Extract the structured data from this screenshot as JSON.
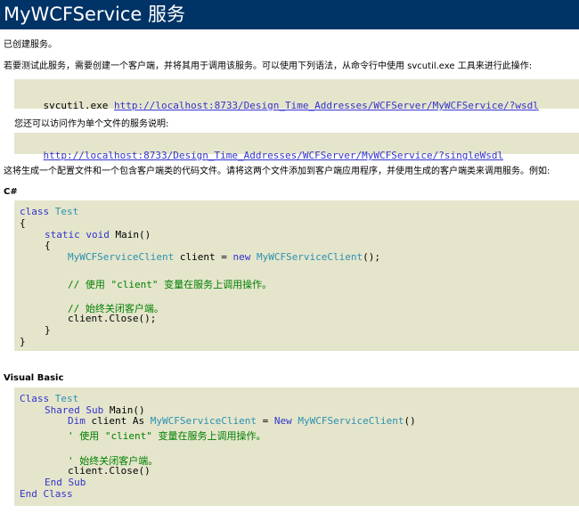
{
  "header": {
    "title": "MyWCFService 服务"
  },
  "intro": {
    "created": "已创建服务。",
    "test_instructions": "若要测试此服务，需要创建一个客户端，并将其用于调用该服务。可以使用下列语法，从命令行中使用 svcutil.exe 工具来进行此操作:",
    "single_file_note": "您还可以访问作为单个文件的服务说明:",
    "generate_note": "这将生成一个配置文件和一个包含客户端类的代码文件。请将这两个文件添加到客户端应用程序，并使用生成的客户端类来调用服务。例如:"
  },
  "svcutil": {
    "command": "svcutil.exe ",
    "wsdl_url": "http://localhost:8733/Design_Time_Addresses/WCFServer/MyWCFService/?wsdl"
  },
  "single_wsdl": {
    "url": "http://localhost:8733/Design_Time_Addresses/WCFServer/MyWCFService/?singleWsdl"
  },
  "csharp": {
    "heading": "C#",
    "kw_class": "class",
    "class_name": "Test",
    "brace_open": "{",
    "brace_close": "}",
    "kw_static": "static",
    "kw_void": "void",
    "main": "Main()",
    "client_type": "MyWCFServiceClient",
    "client_decl": " client = ",
    "kw_new": "new",
    "ctor_type": "MyWCFServiceClient",
    "ctor_end": "();",
    "comment1": "// 使用 \"client\" 变量在服务上调用操作。",
    "comment2": "// 始终关闭客户端。",
    "close_call": "client.Close();"
  },
  "vb": {
    "heading": "Visual Basic",
    "kw_class": "Class",
    "class_name": "Test",
    "kw_shared": "Shared",
    "kw_sub": "Sub",
    "main": "Main()",
    "kw_dim": "Dim",
    "dim_mid": " client As ",
    "client_type": "MyWCFServiceClient",
    "eq": " = ",
    "kw_new": "New",
    "ctor_type": "MyWCFServiceClient",
    "ctor_end": "()",
    "comment1": "' 使用 \"client\" 变量在服务上调用操作。",
    "comment2": "' 始终关闭客户端。",
    "close_call": "client.Close()",
    "kw_end_sub": "End Sub",
    "kw_end_class": "End Class"
  }
}
